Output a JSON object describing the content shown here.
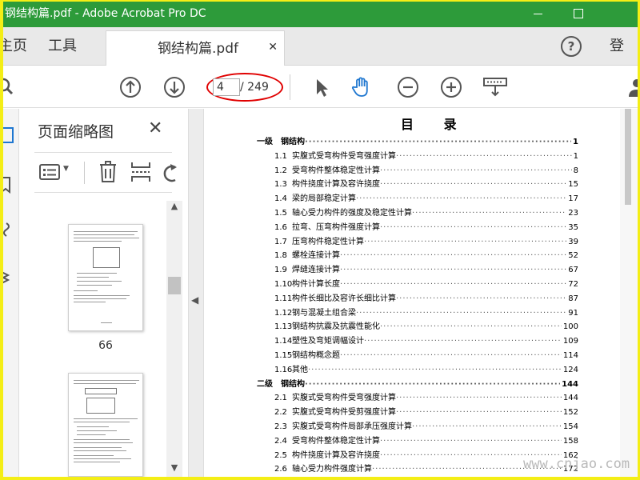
{
  "window": {
    "title": "钢结构篇.pdf - Adobe Acrobat Pro DC"
  },
  "tabs": {
    "home": "主页",
    "tools": "工具",
    "document": "钢结构篇.pdf",
    "login": "登录"
  },
  "toolbar": {
    "current_page": "4",
    "total_pages": "/ 249"
  },
  "thumbnails": {
    "title": "页面缩略图",
    "pages": [
      {
        "label": "66"
      },
      {
        "label": ""
      }
    ]
  },
  "document": {
    "toc_heading": "目  录",
    "entries": [
      {
        "level": 1,
        "num": "一级",
        "title": "钢结构",
        "page": "1"
      },
      {
        "level": 2,
        "num": "1.1",
        "title": "实腹式受弯构件受弯强度计算",
        "page": "1"
      },
      {
        "level": 2,
        "num": "1.2",
        "title": "受弯构件整体稳定性计算",
        "page": "8"
      },
      {
        "level": 2,
        "num": "1.3",
        "title": "构件挠度计算及容许挠度",
        "page": "15"
      },
      {
        "level": 2,
        "num": "1.4",
        "title": "梁的局部稳定计算",
        "page": "17"
      },
      {
        "level": 2,
        "num": "1.5",
        "title": "轴心受力构件的强度及稳定性计算",
        "page": "23"
      },
      {
        "level": 2,
        "num": "1.6",
        "title": "拉弯、压弯构件强度计算",
        "page": "35"
      },
      {
        "level": 2,
        "num": "1.7",
        "title": "压弯构件稳定性计算",
        "page": "39"
      },
      {
        "level": 2,
        "num": "1.8",
        "title": "螺栓连接计算",
        "page": "52"
      },
      {
        "level": 2,
        "num": "1.9",
        "title": "焊缝连接计算",
        "page": "67"
      },
      {
        "level": 2,
        "num": "1.10",
        "title": "构件计算长度",
        "page": "72"
      },
      {
        "level": 2,
        "num": "1.11",
        "title": "构件长细比及容许长细比计算",
        "page": "87"
      },
      {
        "level": 2,
        "num": "1.12",
        "title": "钢与混凝土组合梁",
        "page": "91"
      },
      {
        "level": 2,
        "num": "1.13",
        "title": "钢结构抗震及抗震性能化",
        "page": "100"
      },
      {
        "level": 2,
        "num": "1.14",
        "title": "塑性及弯矩调幅设计",
        "page": "109"
      },
      {
        "level": 2,
        "num": "1.15",
        "title": "钢结构概念题",
        "page": "114"
      },
      {
        "level": 2,
        "num": "1.16",
        "title": "其他",
        "page": "124"
      },
      {
        "level": 1,
        "num": "二级",
        "title": "钢结构",
        "page": "144"
      },
      {
        "level": 2,
        "num": "2.1",
        "title": "实腹式受弯构件受弯强度计算",
        "page": "144"
      },
      {
        "level": 2,
        "num": "2.2",
        "title": "实腹式受弯构件受剪强度计算",
        "page": "152"
      },
      {
        "level": 2,
        "num": "2.3",
        "title": "实腹式受弯构件局部承压强度计算",
        "page": "154"
      },
      {
        "level": 2,
        "num": "2.4",
        "title": "受弯构件整体稳定性计算",
        "page": "158"
      },
      {
        "level": 2,
        "num": "2.5",
        "title": "构件挠度计算及容许挠度",
        "page": "162"
      },
      {
        "level": 2,
        "num": "2.6",
        "title": "轴心受力构件强度计算",
        "page": "172"
      }
    ]
  },
  "watermark": "www.cnjao.com",
  "colors": {
    "titlebar": "#2d9b3a",
    "highlight_ring": "#e00000",
    "outer_border": "#f4ee16",
    "hand_tool": "#1f77d0"
  }
}
